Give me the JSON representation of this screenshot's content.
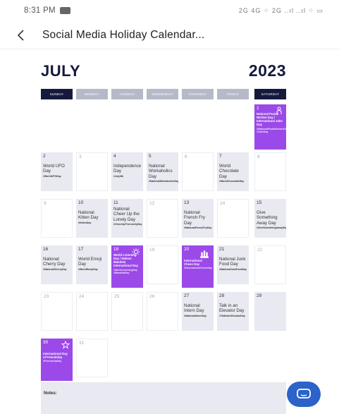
{
  "status_bar": {
    "time": "8:31 PM",
    "icons": "2G 4G ⁘ 2G ..ıl ..ıl ⁘ ▭"
  },
  "app_bar": {
    "title": "Social Media Holiday Calendar..."
  },
  "calendar": {
    "month": "JULY",
    "year": "2023",
    "weekdays": [
      "SUNDAY",
      "MONDAY",
      "TUESDAY",
      "WEDNESDAY",
      "THURSDAY",
      "FRIDAY",
      "SATURDAY"
    ],
    "days": [
      {
        "num": "1",
        "title": "National Postal Worker Day / International Joke Day",
        "tag": "#NationalPostalWorkerDay #JokeDay"
      },
      {
        "num": "2",
        "title": "World UFO Day",
        "tag": "#WorldUFODay"
      },
      {
        "num": "3",
        "title": "",
        "tag": ""
      },
      {
        "num": "4",
        "title": "Independence Day",
        "tag": "#July4th"
      },
      {
        "num": "5",
        "title": "National Workaholics Day",
        "tag": "#NationalWorkaholicsDay"
      },
      {
        "num": "6",
        "title": "",
        "tag": ""
      },
      {
        "num": "7",
        "title": "World Chocolate Day",
        "tag": "#WorldChocolateDay"
      },
      {
        "num": "8",
        "title": "",
        "tag": ""
      },
      {
        "num": "9",
        "title": "",
        "tag": ""
      },
      {
        "num": "10",
        "title": "National Kitten Day",
        "tag": "#KittenDay"
      },
      {
        "num": "11",
        "title": "National Cheer Up the Lonely Day",
        "tag": "#CheerUpTheLonelyDay"
      },
      {
        "num": "12",
        "title": "",
        "tag": ""
      },
      {
        "num": "13",
        "title": "National French Fry Day",
        "tag": "#NationalFrenchFryDay"
      },
      {
        "num": "14",
        "title": "",
        "tag": ""
      },
      {
        "num": "15",
        "title": "Give Something Away Day",
        "tag": "#GiveSomethingAwayDay"
      },
      {
        "num": "16",
        "title": "National Cherry Day",
        "tag": "#NationalCherryDay"
      },
      {
        "num": "17",
        "title": "World Emoji Day",
        "tag": "#WorldEmojiDay"
      },
      {
        "num": "18",
        "title": "World Listening Day / Nelson Mandela International Day",
        "tag": "#WorldListeningDay #MandelaDay"
      },
      {
        "num": "19",
        "title": "",
        "tag": ""
      },
      {
        "num": "20",
        "title": "International Chess Day",
        "tag": "#InternationalChessDay"
      },
      {
        "num": "21",
        "title": "National Junk Food Day",
        "tag": "#NationalJunkFoodDay"
      },
      {
        "num": "22",
        "title": "",
        "tag": ""
      },
      {
        "num": "23",
        "title": "",
        "tag": ""
      },
      {
        "num": "24",
        "title": "",
        "tag": ""
      },
      {
        "num": "25",
        "title": "",
        "tag": ""
      },
      {
        "num": "26",
        "title": "",
        "tag": ""
      },
      {
        "num": "27",
        "title": "National Intern Day",
        "tag": "#NationalInternDay"
      },
      {
        "num": "28",
        "title": "Talk in an Elevator Day",
        "tag": "#TalkInAnElevatorDay"
      },
      {
        "num": "29",
        "title": "",
        "tag": ""
      },
      {
        "num": "30",
        "title": "International Day of Friendship",
        "tag": "#FriendshipDay"
      },
      {
        "num": "31",
        "title": "",
        "tag": ""
      }
    ]
  },
  "notes": {
    "label": "Notes:"
  },
  "colors": {
    "navy": "#151a3d",
    "purple": "#9b49e8",
    "cell_gray": "#e8e9f1",
    "fab_blue": "#2b63c8"
  }
}
